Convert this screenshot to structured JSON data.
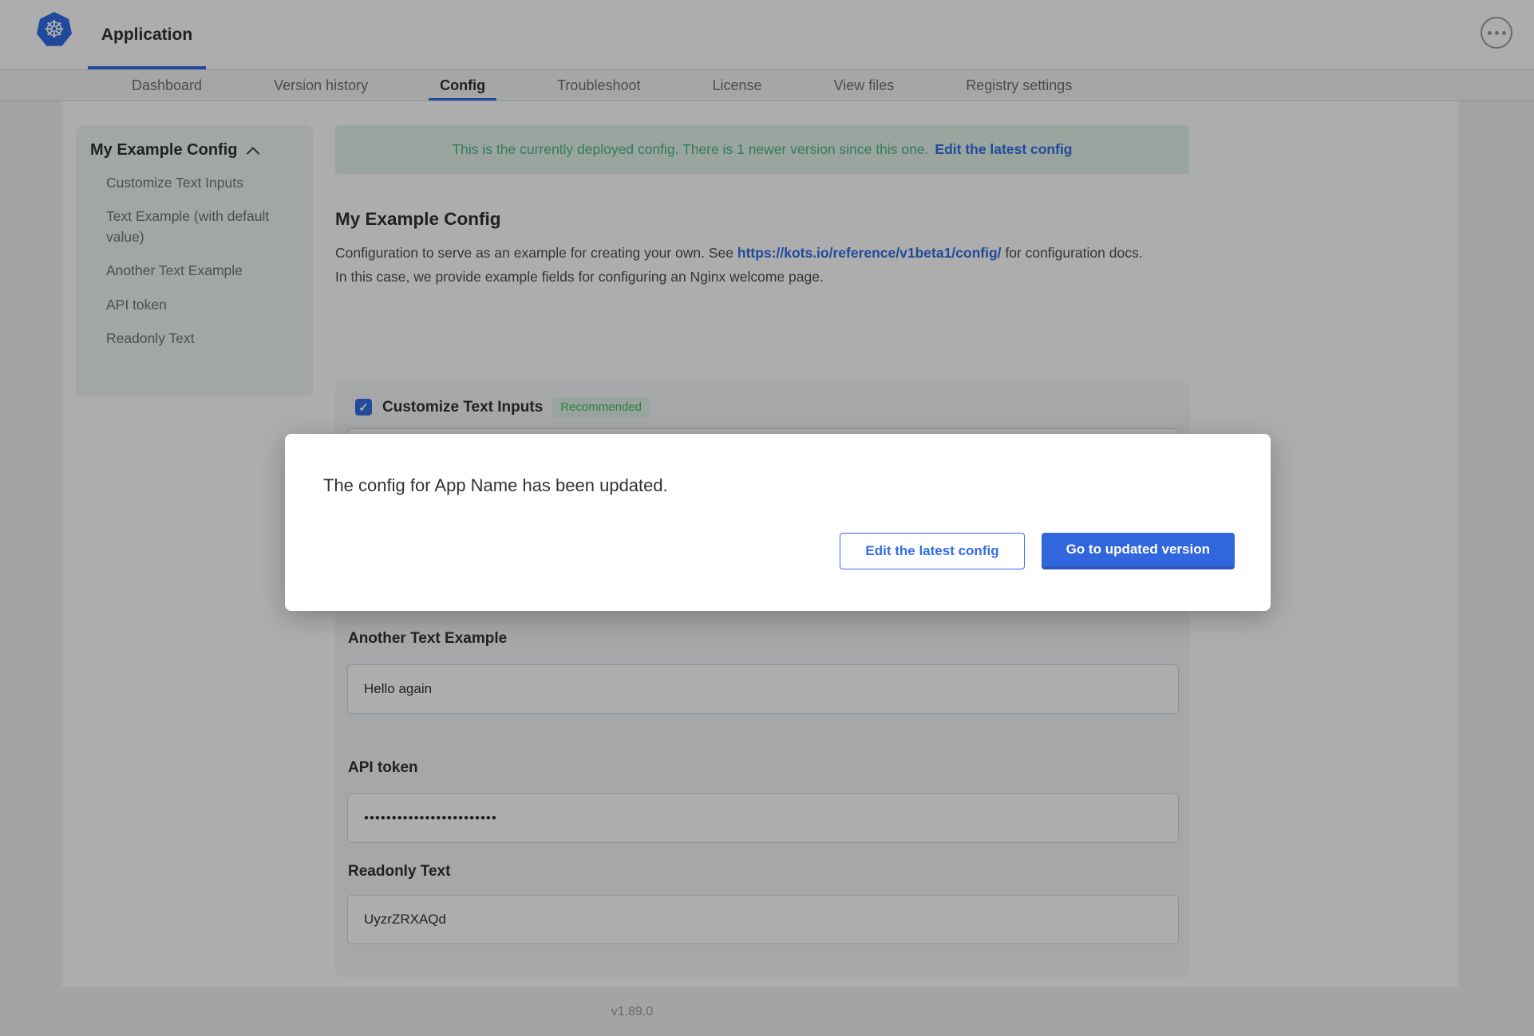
{
  "header": {
    "app_tab": "Application"
  },
  "nav": {
    "items": [
      "Dashboard",
      "Version history",
      "Config",
      "Troubleshoot",
      "License",
      "View files",
      "Registry settings"
    ],
    "active": "Config"
  },
  "sidebar": {
    "title": "My Example Config",
    "items": [
      "Customize Text Inputs",
      "Text Example (with default value)",
      "Another Text Example",
      "API token",
      "Readonly Text"
    ]
  },
  "banner": {
    "message": "This is the currently deployed config. There is 1 newer version since this one.",
    "link_label": "Edit the latest config"
  },
  "content": {
    "title": "My Example Config",
    "description": {
      "before": "Configuration to serve as an example for creating your own. See ",
      "link": "https://kots.io/reference/v1beta1/config/",
      "after": " for configuration docs. In this case, we provide example fields for configuring an Nginx welcome page."
    },
    "group": {
      "label": "Customize Text Inputs",
      "badge": "Recommended",
      "checked": true
    },
    "fields": [
      {
        "label": "Another Text Example",
        "value": "Hello again",
        "type": "text"
      },
      {
        "label": "API token",
        "value": "••••••••••••••••••••••••",
        "type": "password"
      },
      {
        "label": "Readonly Text",
        "value": "UyzrZRXAQd",
        "type": "readonly"
      }
    ]
  },
  "modal": {
    "message": "The config for App Name has been updated.",
    "secondary_label": "Edit the latest config",
    "primary_label": "Go to updated version"
  },
  "footer": {
    "version": "v1.89.0"
  },
  "icons": {
    "kubernetes_wheel": "☸",
    "checkmark": "✓"
  },
  "colors": {
    "accent_blue": "#326de6",
    "green_text": "#4db489",
    "banner_bg": "#e3f3ea"
  }
}
